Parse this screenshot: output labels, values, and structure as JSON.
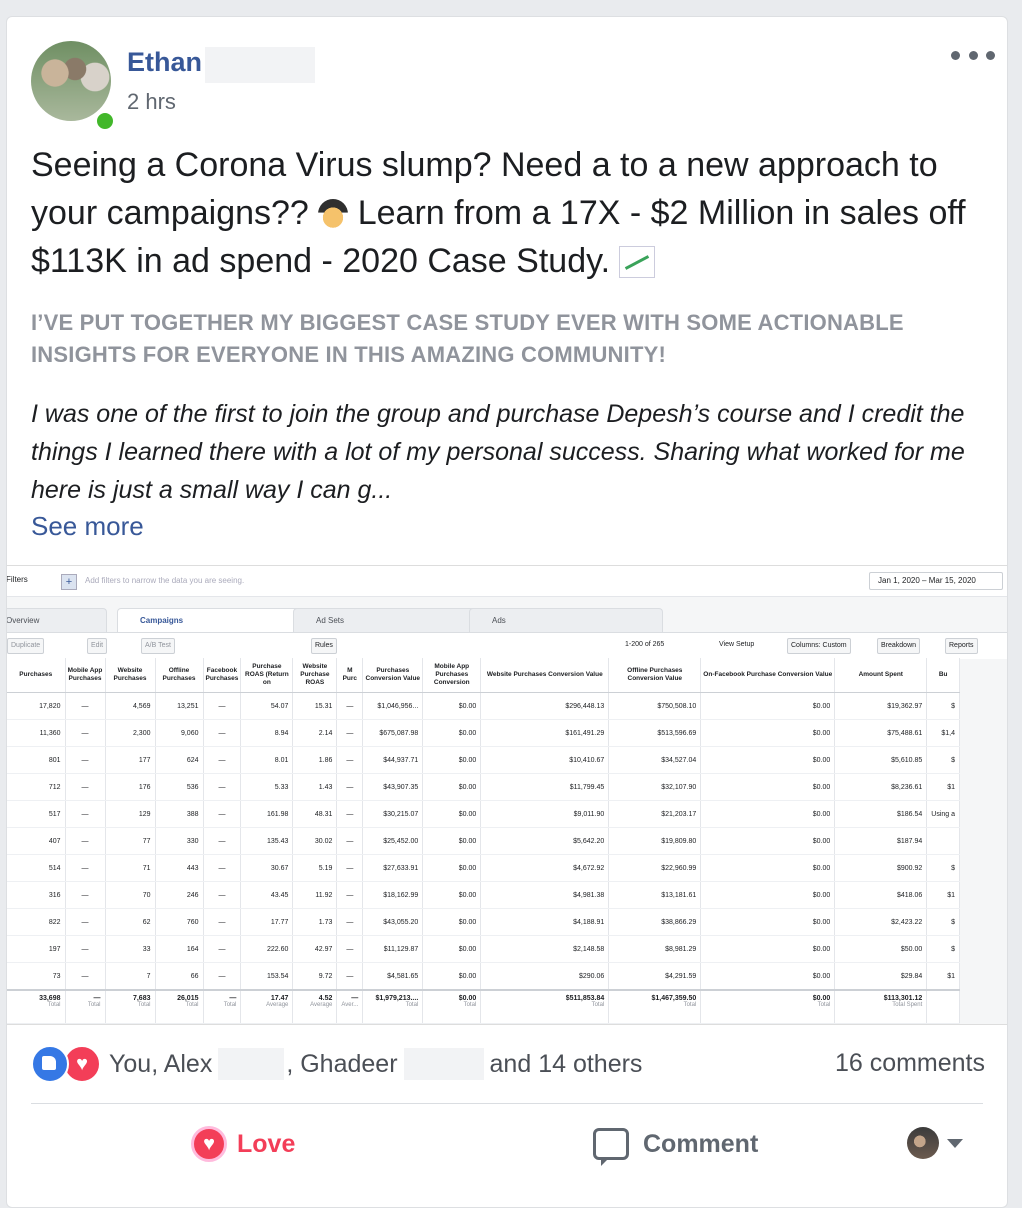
{
  "post": {
    "author_first": "Ethan",
    "time": "2 hrs",
    "headline_1": "Seeing a Corona Virus slump? Need a to a new approach to your campaigns?? ",
    "headline_2": " Learn from a 17X -  $2 Million in sales off $113K in ad spend - 2020 Case Study. ",
    "subhead": "I’ve put together my biggest case study ever with some actionable insights for everyone in this amazing community!",
    "body": "I was one of the first to join the group and purchase Depesh’s course and I credit the things I learned there with a lot of my personal success. Sharing what worked for me here is just a small way I can g...",
    "see_more": "See more"
  },
  "screenshot": {
    "filters": "Filters",
    "filter_hint": "Add filters to narrow the data you are seeing.",
    "date_range": "Jan 1, 2020 – Mar 15, 2020",
    "tabs": [
      "Overview",
      "Campaigns",
      "Ad Sets",
      "Ads"
    ],
    "toolbar": {
      "duplicate": "Duplicate",
      "edit": "Edit",
      "ab_test": "A/B Test",
      "rules": "Rules",
      "pagination": "1-200 of 265",
      "view_setup": "View Setup",
      "columns": "Columns: Custom",
      "breakdown": "Breakdown",
      "reports": "Reports"
    },
    "columns": [
      "Purchases",
      "Mobile App Purchases",
      "Website Purchases",
      "Offline Purchases",
      "Facebook Purchases",
      "Purchase ROAS (Return on",
      "Website Purchase ROAS",
      "M Purc",
      "Purchases Conversion Value",
      "Mobile App Purchases Conversion",
      "Website Purchases Conversion Value",
      "Offline Purchases Conversion Value",
      "On-Facebook Purchase Conversion Value",
      "Amount Spent",
      "Bu"
    ],
    "rows": [
      [
        "17,820",
        "—",
        "4,569",
        "13,251",
        "—",
        "54.07",
        "15.31",
        "—",
        "$1,046,956...",
        "$0.00",
        "$296,448.13",
        "$750,508.10",
        "$0.00",
        "$19,362.97",
        "$"
      ],
      [
        "11,360",
        "—",
        "2,300",
        "9,060",
        "—",
        "8.94",
        "2.14",
        "—",
        "$675,087.98",
        "$0.00",
        "$161,491.29",
        "$513,596.69",
        "$0.00",
        "$75,488.61",
        "$1,4"
      ],
      [
        "801",
        "—",
        "177",
        "624",
        "—",
        "8.01",
        "1.86",
        "—",
        "$44,937.71",
        "$0.00",
        "$10,410.67",
        "$34,527.04",
        "$0.00",
        "$5,610.85",
        "$"
      ],
      [
        "712",
        "—",
        "176",
        "536",
        "—",
        "5.33",
        "1.43",
        "—",
        "$43,907.35",
        "$0.00",
        "$11,799.45",
        "$32,107.90",
        "$0.00",
        "$8,236.61",
        "$1"
      ],
      [
        "517",
        "—",
        "129",
        "388",
        "—",
        "161.98",
        "48.31",
        "—",
        "$30,215.07",
        "$0.00",
        "$9,011.90",
        "$21,203.17",
        "$0.00",
        "$186.54",
        "Using a"
      ],
      [
        "407",
        "—",
        "77",
        "330",
        "—",
        "135.43",
        "30.02",
        "—",
        "$25,452.00",
        "$0.00",
        "$5,642.20",
        "$19,809.80",
        "$0.00",
        "$187.94",
        ""
      ],
      [
        "514",
        "—",
        "71",
        "443",
        "—",
        "30.67",
        "5.19",
        "—",
        "$27,633.91",
        "$0.00",
        "$4,672.92",
        "$22,960.99",
        "$0.00",
        "$900.92",
        "$"
      ],
      [
        "316",
        "—",
        "70",
        "246",
        "—",
        "43.45",
        "11.92",
        "—",
        "$18,162.99",
        "$0.00",
        "$4,981.38",
        "$13,181.61",
        "$0.00",
        "$418.06",
        "$1"
      ],
      [
        "822",
        "—",
        "62",
        "760",
        "—",
        "17.77",
        "1.73",
        "—",
        "$43,055.20",
        "$0.00",
        "$4,188.91",
        "$38,866.29",
        "$0.00",
        "$2,423.22",
        "$"
      ],
      [
        "197",
        "—",
        "33",
        "164",
        "—",
        "222.60",
        "42.97",
        "—",
        "$11,129.87",
        "$0.00",
        "$2,148.58",
        "$8,981.29",
        "$0.00",
        "$50.00",
        "$"
      ],
      [
        "73",
        "—",
        "7",
        "66",
        "—",
        "153.54",
        "9.72",
        "—",
        "$4,581.65",
        "$0.00",
        "$290.06",
        "$4,291.59",
        "$0.00",
        "$29.84",
        "$1"
      ]
    ],
    "totals": [
      [
        "33,698",
        "Total"
      ],
      [
        "—",
        "Total"
      ],
      [
        "7,683",
        "Total"
      ],
      [
        "26,015",
        "Total"
      ],
      [
        "—",
        "Total"
      ],
      [
        "17.47",
        "Average"
      ],
      [
        "4.52",
        "Average"
      ],
      [
        "—",
        "Aver..."
      ],
      [
        "$1,979,213....",
        "Total"
      ],
      [
        "$0.00",
        "Total"
      ],
      [
        "$511,853.84",
        "Total"
      ],
      [
        "$1,467,359.50",
        "Total"
      ],
      [
        "$0.00",
        "Total"
      ],
      [
        "$113,301.12",
        "Total Spent"
      ],
      [
        "",
        ""
      ]
    ]
  },
  "reactions": {
    "you": "You, Alex",
    "ghadeer": ", Ghadeer",
    "others": "and 14 others",
    "comments": "16 comments"
  },
  "actions": {
    "love": "Love",
    "comment": "Comment"
  },
  "icons": [
    "like-icon",
    "love-icon",
    "comment-icon",
    "more-icon",
    "caret-icon"
  ],
  "colors": {
    "link": "#385898",
    "love": "#f33e58",
    "like": "#3578e5",
    "online": "#42b72a"
  }
}
